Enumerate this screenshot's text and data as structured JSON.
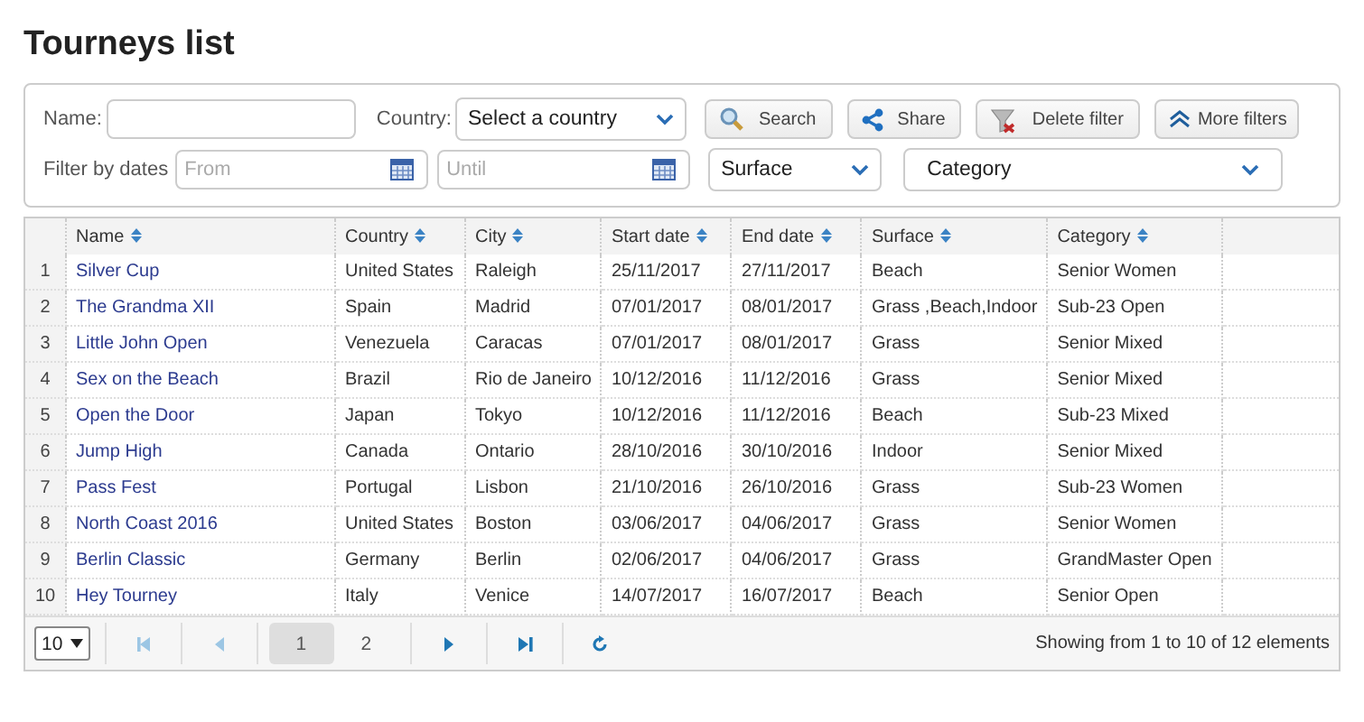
{
  "title": "Tourneys list",
  "filters": {
    "name_label": "Name:",
    "country_label": "Country:",
    "country_select": "Select a country",
    "buttons": [
      {
        "kind": "search",
        "label": "Search"
      },
      {
        "kind": "share",
        "label": "Share"
      },
      {
        "kind": "delete",
        "label": "Delete filter"
      },
      {
        "kind": "more",
        "label": "More filters"
      }
    ],
    "dates_label": "Filter by dates",
    "from_placeholder": "From",
    "until_placeholder": "Until",
    "surface_select": "Surface",
    "category_select": "Category"
  },
  "table": {
    "columns": [
      "",
      "Name",
      "Country",
      "City",
      "Start date",
      "End date",
      "Surface",
      "Category"
    ],
    "rows": [
      [
        "1",
        "Silver Cup",
        "United States",
        "Raleigh",
        "25/11/2017",
        "27/11/2017",
        "Beach",
        "Senior Women"
      ],
      [
        "2",
        "The Grandma XII",
        "Spain",
        "Madrid",
        "07/01/2017",
        "08/01/2017",
        "Grass ,Beach,Indoor",
        "Sub-23 Open"
      ],
      [
        "3",
        "Little John Open",
        "Venezuela",
        "Caracas",
        "07/01/2017",
        "08/01/2017",
        "Grass",
        "Senior Mixed"
      ],
      [
        "4",
        "Sex on the Beach",
        "Brazil",
        "Rio de Janeiro",
        "10/12/2016",
        "11/12/2016",
        "Grass",
        "Senior Mixed"
      ],
      [
        "5",
        "Open the Door",
        "Japan",
        "Tokyo",
        "10/12/2016",
        "11/12/2016",
        "Beach",
        "Sub-23 Mixed"
      ],
      [
        "6",
        "Jump High",
        "Canada",
        "Ontario",
        "28/10/2016",
        "30/10/2016",
        "Indoor",
        "Senior Mixed"
      ],
      [
        "7",
        "Pass Fest",
        "Portugal",
        "Lisbon",
        "21/10/2016",
        "26/10/2016",
        "Grass",
        "Sub-23 Women"
      ],
      [
        "8",
        "North Coast 2016",
        "United States",
        "Boston",
        "03/06/2017",
        "04/06/2017",
        "Grass",
        "Senior Women"
      ],
      [
        "9",
        "Berlin Classic",
        "Germany",
        "Berlin",
        "02/06/2017",
        "04/06/2017",
        "Grass",
        "GrandMaster Open"
      ],
      [
        "10",
        "Hey Tourney",
        "Italy",
        "Venice",
        "14/07/2017",
        "16/07/2017",
        "Beach",
        "Senior Open"
      ]
    ]
  },
  "pager": {
    "page_size": "10",
    "first_disabled": true,
    "prev_disabled": true,
    "pages": [
      {
        "label": "1",
        "selected": true
      },
      {
        "label": "2",
        "selected": false
      }
    ],
    "status": "Showing from 1 to 10 of 12 elements"
  }
}
